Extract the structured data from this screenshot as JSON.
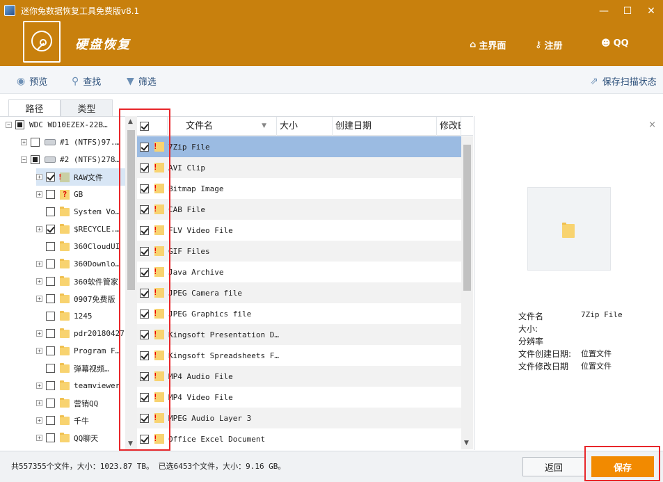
{
  "window": {
    "title": "迷你兔数据恢复工具免费版v8.1",
    "ctrl_min": "—",
    "ctrl_max": "☐",
    "ctrl_close": "✕"
  },
  "header": {
    "brand": "硬盘恢复",
    "nav": {
      "home": "主界面",
      "register": "注册",
      "qq": "QQ"
    }
  },
  "toolbar": {
    "preview": "预览",
    "find": "查找",
    "filter": "筛选",
    "save_scan": "保存扫描状态"
  },
  "tabs": {
    "path": "路径",
    "type": "类型"
  },
  "tree": [
    {
      "label": "WDC WD10EZEX-22B…",
      "expander": "−",
      "check": "full",
      "icon": "none",
      "indent": 0
    },
    {
      "label": "#1 (NTFS)97.…",
      "expander": "+",
      "check": "none",
      "icon": "drive",
      "indent": 1
    },
    {
      "label": "#2 (NTFS)278…",
      "expander": "−",
      "check": "full",
      "icon": "drive",
      "indent": 1
    },
    {
      "label": "RAW文件",
      "expander": "+",
      "check": "chk",
      "icon": "raw",
      "indent": 2,
      "selected": true
    },
    {
      "label": "GB",
      "expander": "+",
      "check": "none",
      "icon": "q",
      "indent": 2
    },
    {
      "label": "System Vo…",
      "expander": "",
      "check": "none",
      "icon": "folder",
      "indent": 2
    },
    {
      "label": "$RECYCLE.…",
      "expander": "+",
      "check": "chk",
      "icon": "folder",
      "indent": 2
    },
    {
      "label": "360CloudUI",
      "expander": "",
      "check": "none",
      "icon": "folder",
      "indent": 2
    },
    {
      "label": "360Downlo…",
      "expander": "+",
      "check": "none",
      "icon": "folder",
      "indent": 2
    },
    {
      "label": "360软件管家",
      "expander": "+",
      "check": "none",
      "icon": "folder",
      "indent": 2
    },
    {
      "label": "0907免费版",
      "expander": "+",
      "check": "none",
      "icon": "folder",
      "indent": 2
    },
    {
      "label": "1245",
      "expander": "",
      "check": "none",
      "icon": "folder",
      "indent": 2
    },
    {
      "label": "pdr20180427",
      "expander": "+",
      "check": "none",
      "icon": "folder",
      "indent": 2
    },
    {
      "label": "Program F…",
      "expander": "+",
      "check": "none",
      "icon": "folder",
      "indent": 2
    },
    {
      "label": "弹幕视频…",
      "expander": "",
      "check": "none",
      "icon": "folder",
      "indent": 2
    },
    {
      "label": "teamviewer",
      "expander": "+",
      "check": "none",
      "icon": "folder",
      "indent": 2
    },
    {
      "label": "营销QQ",
      "expander": "+",
      "check": "none",
      "icon": "folder",
      "indent": 2
    },
    {
      "label": "千牛",
      "expander": "+",
      "check": "none",
      "icon": "folder",
      "indent": 2
    },
    {
      "label": "QQ聊天",
      "expander": "+",
      "check": "none",
      "icon": "folder",
      "indent": 2
    }
  ],
  "columns": {
    "name": "文件名",
    "size": "大小",
    "created": "创建日期",
    "modified": "修改E"
  },
  "files": [
    "7Zip File",
    "AVI Clip",
    "Bitmap Image",
    "CAB File",
    "FLV Video File",
    "GIF Files",
    "Java Archive",
    "JPEG Camera file",
    "JPEG Graphics file",
    "Kingsoft Presentation D…",
    "Kingsoft Spreadsheets F…",
    "MP4 Audio File",
    "MP4 Video File",
    "MPEG Audio Layer 3",
    "Office Excel Document"
  ],
  "preview": {
    "close": "×",
    "props": [
      {
        "k": "文件名",
        "v": "7Zip File"
      },
      {
        "k": "大小:",
        "v": ""
      },
      {
        "k": "分辨率",
        "v": ""
      },
      {
        "k": "文件创建日期:",
        "v": "位置文件"
      },
      {
        "k": "文件修改日期",
        "v": "位置文件"
      }
    ]
  },
  "status": {
    "summary": "共557355个文件，大小：1023.87 TB。 已选6453个文件，大小：9.16 GB。",
    "back": "返回",
    "save": "保存"
  }
}
